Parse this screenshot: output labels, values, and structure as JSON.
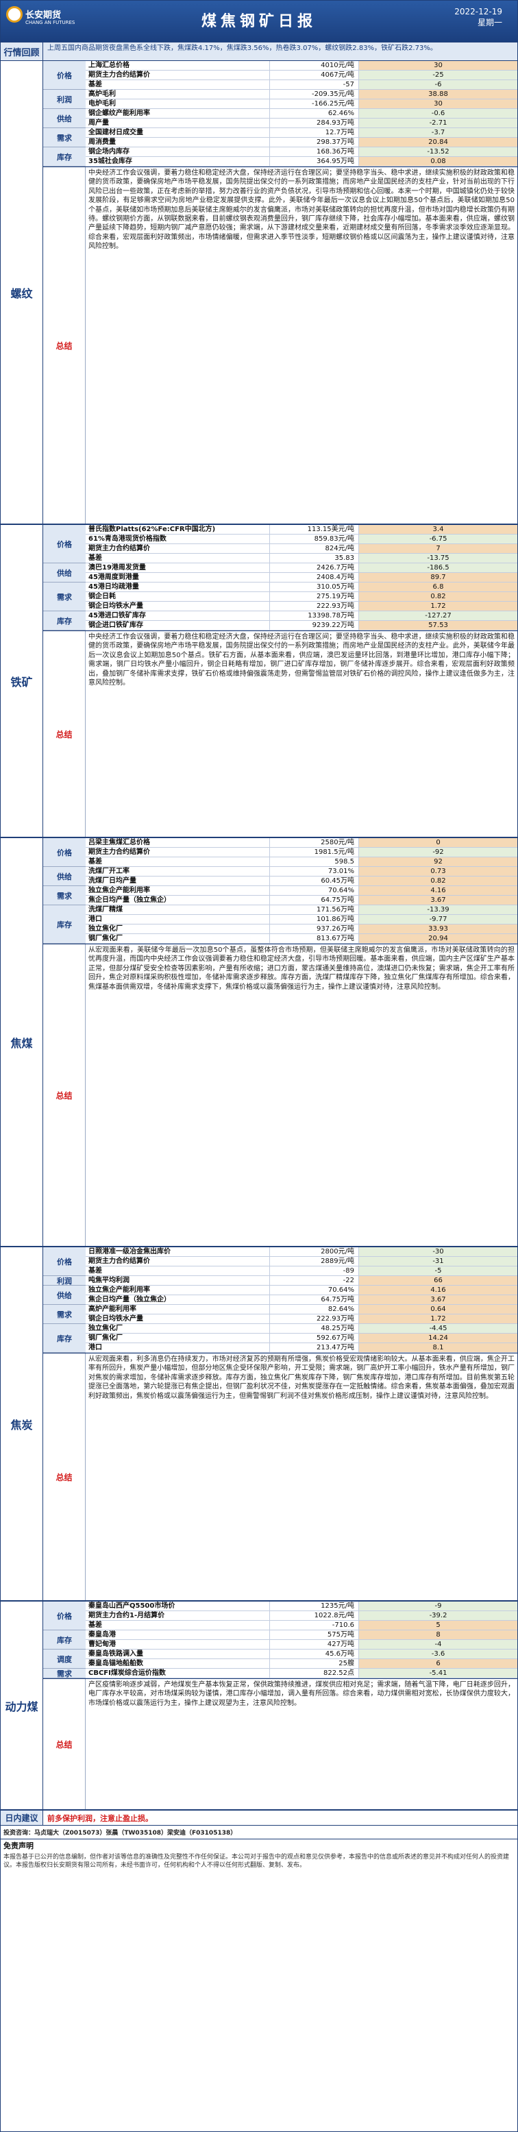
{
  "header": {
    "logo_text": "长安期货",
    "logo_sub": "CHANG AN FUTURES",
    "title": "煤焦钢矿日报",
    "date": "2022-12-19",
    "weekday": "星期一"
  },
  "market_review": {
    "label": "行情回顾",
    "text": "上周五国内商品期货夜盘黑色系全线下跌，焦煤跌4.17%，焦煤跌3.56%，热卷跌3.07%，螺纹钢跌2.83%，铁矿石跌2.73%。"
  },
  "sections": [
    {
      "name": "螺纹",
      "categories": [
        {
          "label": "价格",
          "rows": [
            [
              "上海汇总价格",
              "4010元/吨",
              "30",
              "pos"
            ],
            [
              "期货主力合约结算价",
              "4067元/吨",
              "-25",
              "neg"
            ],
            [
              "基差",
              "-57",
              "-6",
              "neg"
            ]
          ]
        },
        {
          "label": "利润",
          "rows": [
            [
              "高炉毛利",
              "-209.35元/吨",
              "38.88",
              "pos"
            ],
            [
              "电炉毛利",
              "-166.25元/吨",
              "30",
              "pos"
            ]
          ]
        },
        {
          "label": "供给",
          "rows": [
            [
              "钢企螺纹产能利用率",
              "62.46%",
              "-0.6",
              "neg"
            ],
            [
              "周产量",
              "284.93万吨",
              "-2.71",
              "neg"
            ]
          ]
        },
        {
          "label": "需求",
          "rows": [
            [
              "全国建材日成交量",
              "12.7万吨",
              "-3.7",
              "neg"
            ],
            [
              "周消费量",
              "298.37万吨",
              "20.84",
              "pos"
            ]
          ]
        },
        {
          "label": "库存",
          "rows": [
            [
              "钢企场内库存",
              "168.36万吨",
              "-13.52",
              "neg"
            ],
            [
              "35城社会库存",
              "364.95万吨",
              "0.08",
              "pos"
            ]
          ]
        }
      ],
      "summary": "中央经济工作会议强调，要着力稳住和稳定经济大盘，保持经济运行在合理区间；要坚持稳字当头、稳中求进，继续实施积极的财政政策和稳健的货币政策，要确保房地产市场平稳发展，国务院提出保交付的一系列政策措施；而房地产业是国民经济的支柱产业，针对当前出现的下行风险已出台一些政策，正在考虑新的举措，努力改善行业的资产负债状况，引导市场预期和信心回暖。本来一个时期，中国城镇化仍处于较快发展阶段，有足够需求空间为房地产业稳定发展提供支撑。此外，美联储今年最后一次议息会议上如期加息50个基点后，美联储如期加息50个基点，美联储如市场预期加息后美联储主席鲍威尔的发言偏鹰派，市场对美联储政策转向的担忧再度升温，但市场对国内稳增长政策仍有期待。螺纹钢期价方面，从钢联数据来看，目前螺纹钢表观消费量回升，钢厂库存继续下降，社会库存小幅增加。基本面来看，供应端，螺纹钢产量延续下降趋势，短期内钢厂减产意愿仍较强；需求端，从下游建材成交量来看，近期建材成交量有所回落，冬季需求淡季效应逐渐显现。综合来看，宏观层面利好政策频出，市场情绪偏暖，但需求进入季节性淡季，短期螺纹钢价格或以区间震荡为主，操作上建议谨慎对待，注意风险控制。"
    },
    {
      "name": "铁矿",
      "categories": [
        {
          "label": "价格",
          "rows": [
            [
              "普氏指数Platts(62%Fe:CFR中国北方)",
              "113.15美元/吨",
              "3.4",
              "pos"
            ],
            [
              "61%青岛港现货价格指数",
              "859.83元/吨",
              "-6.75",
              "neg"
            ],
            [
              "期货主力合约结算价",
              "824元/吨",
              "7",
              "pos"
            ],
            [
              "基差",
              "35.83",
              "-13.75",
              "neg"
            ]
          ]
        },
        {
          "label": "供给",
          "rows": [
            [
              "澳巴19港周发货量",
              "2426.7万吨",
              "-186.5",
              "neg"
            ],
            [
              "45港周度到港量",
              "2408.4万吨",
              "89.7",
              "pos"
            ]
          ]
        },
        {
          "label": "需求",
          "rows": [
            [
              "45港日均疏港量",
              "310.05万吨",
              "6.8",
              "pos"
            ],
            [
              "钢企日耗",
              "275.19万吨",
              "0.82",
              "pos"
            ],
            [
              "钢企日均铁水产量",
              "222.93万吨",
              "1.72",
              "pos"
            ]
          ]
        },
        {
          "label": "库存",
          "rows": [
            [
              "45港进口铁矿库存",
              "13398.78万吨",
              "-127.27",
              "neg"
            ],
            [
              "钢企进口铁矿库存",
              "9239.22万吨",
              "57.53",
              "pos"
            ]
          ]
        }
      ],
      "summary": "中央经济工作会议强调，要着力稳住和稳定经济大盘，保持经济运行在合理区间；要坚持稳字当头、稳中求进，继续实施积极的财政政策和稳健的货币政策，要确保房地产市场平稳发展，国务院提出保交付的一系列政策措施；而房地产业是国民经济的支柱产业。此外，美联储今年最后一次议息会议上如期加息50个基点。铁矿石方面，从基本面来看，供应端，澳巴发运量环比回落，到港量环比增加，港口库存小幅下降；需求端，钢厂日均铁水产量小幅回升，钢企日耗略有增加，钢厂进口矿库存增加，钢厂冬储补库逐步展开。综合来看，宏观层面利好政策频出，叠加钢厂冬储补库需求支撑，铁矿石价格或维持偏强震荡走势，但需警惕监管层对铁矿石价格的调控风险，操作上建议逢低做多为主，注意风险控制。"
    },
    {
      "name": "焦煤",
      "categories": [
        {
          "label": "价格",
          "rows": [
            [
              "吕梁主焦煤汇总价格",
              "2580元/吨",
              "0",
              "zero"
            ],
            [
              "期货主力合约结算价",
              "1981.5元/吨",
              "-92",
              "neg"
            ],
            [
              "基差",
              "598.5",
              "92",
              "pos"
            ]
          ]
        },
        {
          "label": "供给",
          "rows": [
            [
              "洗煤厂开工率",
              "73.01%",
              "0.73",
              "pos"
            ],
            [
              "洗煤厂日均产量",
              "60.45万吨",
              "0.82",
              "pos"
            ]
          ]
        },
        {
          "label": "需求",
          "rows": [
            [
              "独立焦企产能利用率",
              "70.64%",
              "4.16",
              "pos"
            ],
            [
              "焦企日均产量（独立焦企）",
              "64.75万吨",
              "3.67",
              "pos"
            ]
          ]
        },
        {
          "label": "库存",
          "rows": [
            [
              "洗煤厂精煤",
              "171.56万吨",
              "-13.39",
              "neg"
            ],
            [
              "港口",
              "101.86万吨",
              "-9.77",
              "neg"
            ],
            [
              "独立焦化厂",
              "937.26万吨",
              "33.93",
              "pos"
            ],
            [
              "钢厂焦化厂",
              "813.67万吨",
              "20.94",
              "pos"
            ]
          ]
        }
      ],
      "summary": "从宏观面来看，美联储今年最后一次加息50个基点，虽整体符合市场预期，但美联储主席鲍威尔的发言偏鹰派，市场对美联储政策转向的担忧再度升温，而国内中央经济工作会议强调要着力稳住和稳定经济大盘，引导市场预期回暖。基本面来看，供应端，国内主产区煤矿生产基本正常，但部分煤矿受安全检查等因素影响，产量有所收缩；进口方面，蒙古煤通关量维持高位，澳煤进口仍未恢复；需求端，焦企开工率有所回升，焦企对原料煤采购积极性增加，冬储补库需求逐步释放。库存方面，洗煤厂精煤库存下降，独立焦化厂焦煤库存有所增加。综合来看，焦煤基本面供需双增，冬储补库需求支撑下，焦煤价格或以震荡偏强运行为主，操作上建议谨慎对待，注意风险控制。"
    },
    {
      "name": "焦炭",
      "categories": [
        {
          "label": "价格",
          "rows": [
            [
              "日照港准一级冶金焦出库价",
              "2800元/吨",
              "-30",
              "neg"
            ],
            [
              "期货主力合约结算价",
              "2889元/吨",
              "-31",
              "neg"
            ],
            [
              "基差",
              "-89",
              "-5",
              "neg"
            ]
          ]
        },
        {
          "label": "利润",
          "rows": [
            [
              "吨焦平均利润",
              "-22",
              "66",
              "pos"
            ]
          ]
        },
        {
          "label": "供给",
          "rows": [
            [
              "独立焦企产能利用率",
              "70.64%",
              "4.16",
              "pos"
            ],
            [
              "焦企日均产量（独立焦企）",
              "64.75万吨",
              "3.67",
              "pos"
            ]
          ]
        },
        {
          "label": "需求",
          "rows": [
            [
              "高炉产能利用率",
              "82.64%",
              "0.64",
              "pos"
            ],
            [
              "钢企日均铁水产量",
              "222.93万吨",
              "1.72",
              "pos"
            ]
          ]
        },
        {
          "label": "库存",
          "rows": [
            [
              "独立焦化厂",
              "48.25万吨",
              "-4.45",
              "neg"
            ],
            [
              "钢厂焦化厂",
              "592.67万吨",
              "14.24",
              "pos"
            ],
            [
              "港口",
              "213.47万吨",
              "8.1",
              "pos"
            ]
          ]
        }
      ],
      "summary": "从宏观面来看，利多消息仍在持续发力，市场对经济复苏的预期有所增强，焦炭价格受宏观情绪影响较大。从基本面来看，供应端，焦企开工率有所回升，焦炭产量小幅增加，但部分地区焦企受环保限产影响，开工受限；需求端，钢厂高炉开工率小幅回升，铁水产量有所增加，钢厂对焦炭的需求增加，冬储补库需求逐步释放。库存方面，独立焦化厂焦炭库存下降，钢厂焦炭库存增加，港口库存有所增加。目前焦炭第五轮提涨已全面落地，第六轮提涨已有焦企提出，但钢厂盈利状况不佳，对焦炭提涨存在一定抵触情绪。综合来看，焦炭基本面偏强，叠加宏观面利好政策频出，焦炭价格或以震荡偏强运行为主，但需警惕钢厂利润不佳对焦炭价格形成压制，操作上建议谨慎对待，注意风险控制。"
    },
    {
      "name": "动力煤",
      "categories": [
        {
          "label": "价格",
          "rows": [
            [
              "秦皇岛山西产Q5500市场价",
              "1235元/吨",
              "-9",
              "neg"
            ],
            [
              "期货主力合约1-月结算价",
              "1022.8元/吨",
              "-39.2",
              "neg"
            ],
            [
              "基差",
              "-710.6",
              "5",
              "pos"
            ]
          ]
        },
        {
          "label": "库存",
          "rows": [
            [
              "秦皇岛港",
              "575万吨",
              "8",
              "pos"
            ],
            [
              "曹妃甸港",
              "427万吨",
              "-4",
              "neg"
            ]
          ]
        },
        {
          "label": "调度",
          "rows": [
            [
              "秦皇岛铁路调入量",
              "45.6万吨",
              "-3.6",
              "neg"
            ],
            [
              "秦皇岛锚地船舶数",
              "25艘",
              "6",
              "pos"
            ]
          ]
        },
        {
          "label": "需求",
          "rows": [
            [
              "CBCFI煤炭综合运价指数",
              "822.52点",
              "-5.41",
              "neg"
            ]
          ]
        }
      ],
      "summary": "产区疫情影响逐步减弱，产地煤炭生产基本恢复正常，保供政策持续推进，煤炭供应相对充足；需求端，随着气温下降，电厂日耗逐步回升，电厂库存水平较高，对市场煤采购较为谨慎，港口库存小幅增加，调入量有所回落。综合来看，动力煤供需相对宽松，长协煤保供力度较大，市场煤价格或以震荡运行为主，操作上建议观望为主，注意风险控制。"
    }
  ],
  "advice": {
    "label": "日内建议",
    "text": "前多保护利润，注意止盈止损。"
  },
  "investment": "投资咨询：马贞瑞大（Z0015073）张晨（TW035108）梁安迪（F03105138）",
  "disclaimer_title": "免责声明",
  "disclaimer": "本报告基于已公开的信息编制，但作者对该等信息的准确性及完整性不作任何保证。本公司对于报告中的观点和意见仅供参考，本报告中的信息或所表述的意见并不构成对任何人的投资建议。本报告版权归长安期货有限公司所有，未经书面许可，任何机构和个人不得以任何形式翻版、复制、发布。"
}
